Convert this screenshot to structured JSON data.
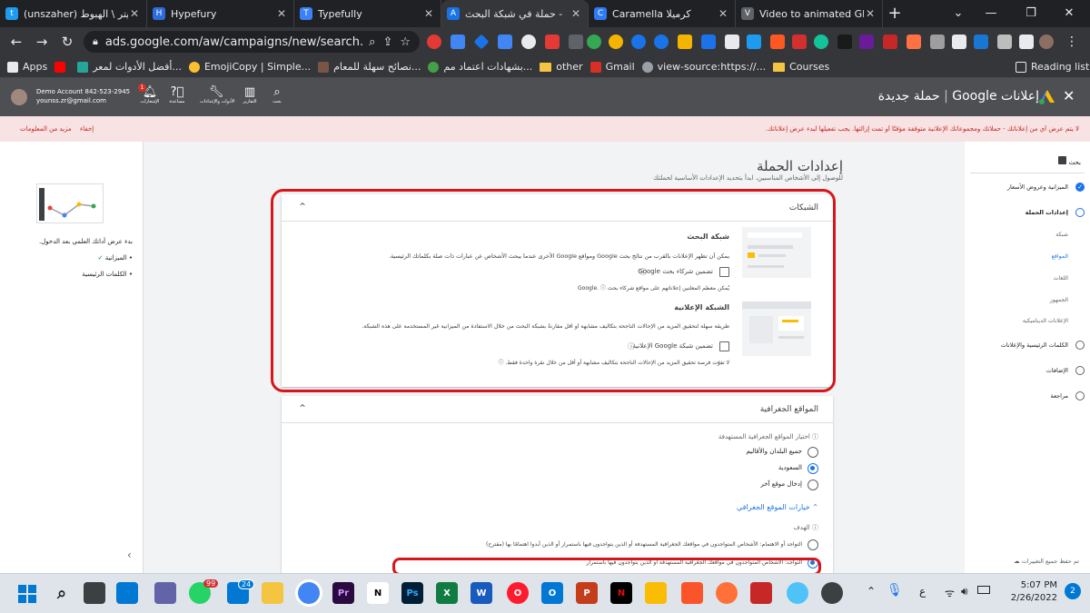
{
  "browser": {
    "tabs": [
      {
        "title": "(unszaher) تويتر \\ الهبوط",
        "color": "#1d9bf0",
        "glyph": "t"
      },
      {
        "title": "Hypefury",
        "color": "#2d6cdf",
        "glyph": "H"
      },
      {
        "title": "Typefully",
        "color": "#3b82f6",
        "glyph": "T"
      },
      {
        "title": "حملة في شبكة البحث -",
        "color": "#1a73e8",
        "glyph": "A"
      },
      {
        "title": "Caramella كرميلا",
        "color": "#2d7cf6",
        "glyph": "C"
      },
      {
        "title": "Video to animated GIF",
        "color": "#5f6368",
        "glyph": "V"
      }
    ],
    "url": "ads.google.com/aw/campaigns/new/search...",
    "bookmarks": [
      "Apps",
      "أفضل الأدوات لمعر...",
      "EmojiCopy | Simple...",
      "نصائح سهلة للمعام...",
      "بشهادات اعتماد مم...",
      "other",
      "Gmail",
      "view-source:https://...",
      "Courses"
    ],
    "reading_list": "Reading list",
    "accent": "#35363a"
  },
  "ads_header": {
    "product": "إعلانات Google",
    "page": "حملة جديدة",
    "account_name": "Demo Account 842-523-2945",
    "account_email": "younss.zr@gmail.com",
    "tools": [
      {
        "label": "بحث",
        "icon": "search-icon"
      },
      {
        "label": "التقارير",
        "icon": "chart-icon"
      },
      {
        "label": "الأدوات والإعدادات",
        "icon": "wrench-icon"
      },
      {
        "label": "مساعدة",
        "icon": "help-icon"
      },
      {
        "label": "الإشعارات",
        "icon": "bell-icon"
      }
    ],
    "notification_count": "1"
  },
  "alert": {
    "message": "لا يتم عرض أيٍ من إعلاناتك - حملاتك ومجموعاتك الإعلانية متوقفة مؤقتًا أو تمت إزالتها. يجب تفعيلها لبدء عرض إعلاناتك.",
    "dismiss": "إخفاء",
    "learn_more": "مزيد من المعلومات"
  },
  "left_panel": {
    "intro": "بدء عرض أداتك العلمي بعد الدخول.",
    "items": [
      "الميزانية",
      "الكلمات الرئيسية"
    ]
  },
  "page": {
    "title": "إعدادات الحملة",
    "subtitle": "للوصول إلى الأشخاص المناسبين، ابدأ بتحديد الإعدادات الأساسية لحملتك"
  },
  "networks": {
    "header": "الشبكات",
    "search_title": "شبكة البحث",
    "search_desc": "يمكن أن تظهر الإعلانات بالقرب من نتائج بحث Google ومواقع Google الأخرى عندما يبحث الأشخاص عن عبارات ذات صلة بكلماتك الرئيسية.",
    "search_checkbox": "تضمين شركاء بحث Google",
    "search_note": "يُمكن معظم المعلنين إعلاناتهم على مواقع شركاء بحث Google.",
    "display_title": "الشبكة الإعلانية",
    "display_desc": "طريقة سهلة لتحقيق المزيد من الإحالات الناجحة بتكاليف مشابهة أو أقل مقارنةً بشبكة البحث من خلال الاستفادة من الميزانية غير المستخدمة على هذه الشبكة.",
    "display_checkbox": "تضمين شبكة Google الإعلانية",
    "display_note": "لا تفوّت فرصة تحقيق المزيد من الإحالات الناجحة بتكاليف مشابهة أو أقل من خلال نقرة واحدة فقط."
  },
  "locations": {
    "header": "المواقع الجغرافية",
    "prompt": "اختيار المواقع الجغرافية المستهدفة",
    "options": [
      "جميع البلدان والأقاليم",
      "السعودية",
      "إدخال موقع آخر"
    ],
    "selected_index": 1,
    "more_options": "خيارات الموقع الجغرافي",
    "target_label": "الهدف",
    "target_options": [
      "التواجد أو الاهتمام: الأشخاص المتواجدون في مواقعك الجغرافية المستهدفة أو الذين يتواجدون فيها باستمرار أو الذين أبدوا اهتمامًا بها (مقترح)",
      "التواجد: الأشخاص المتواجدون في مواقعك الجغرافية المستهدفة أو الذين يتواجدون فيها باستمرار"
    ],
    "target_selected_index": 1
  },
  "right_nav": {
    "top": "بحث",
    "steps": [
      {
        "label": "الميزانية وعروض الأسعار",
        "state": "done"
      },
      {
        "label": "إعدادات الحملة",
        "state": "current"
      },
      {
        "label": "شبكة",
        "state": "sub"
      },
      {
        "label": "المواقع",
        "state": "sub-active"
      },
      {
        "label": "اللغات",
        "state": "sub"
      },
      {
        "label": "الجمهور",
        "state": "sub"
      },
      {
        "label": "الإعلانات الديناميكية",
        "state": "sub"
      },
      {
        "label": "الكلمات الرئيسية والإعلانات",
        "state": "todo"
      },
      {
        "label": "الإضافات",
        "state": "todo"
      },
      {
        "label": "مراجعة",
        "state": "todo"
      }
    ],
    "saved": "تم حفظ جميع التغييرات"
  },
  "taskbar": {
    "time": "5:07 PM",
    "date": "2/26/2022",
    "lang": "ع",
    "whatsapp_badge": "99",
    "mail_badge": "24",
    "notif_badge": "2"
  }
}
